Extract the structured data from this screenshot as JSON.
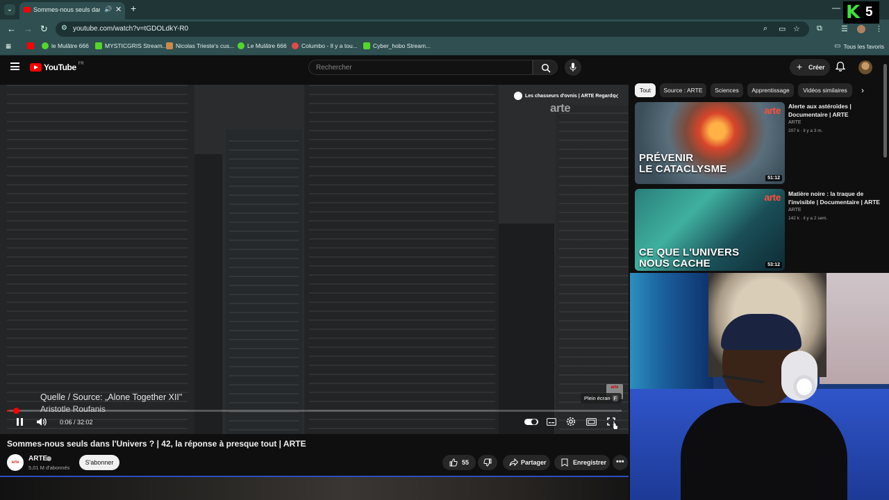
{
  "browser": {
    "tab_title": "Sommes-nous seuls dans l'Univers",
    "url": "youtube.com/watch?v=tGDOLdkY-R0",
    "bookmarks": [
      {
        "label": "",
        "color": "#ff0000"
      },
      {
        "label": "le Mulâtre 666",
        "color": "#53d72b"
      },
      {
        "label": "MYSTICGRIS Stream...",
        "color": "#53d72b"
      },
      {
        "label": "Nicolas Trieste's cus...",
        "color": "#c98a4a"
      },
      {
        "label": "Le Mulâtre 666",
        "color": "#53d72b"
      },
      {
        "label": "Columbo - Il y a tou...",
        "color": "#e04a4a"
      },
      {
        "label": "Cyber_hobo Stream...",
        "color": "#53d72b"
      }
    ],
    "all_bookmarks": "Tous les favoris"
  },
  "youtube": {
    "logo_text": "YouTube",
    "logo_country": "FR",
    "search_placeholder": "Rechercher",
    "create_label": "Créer"
  },
  "player": {
    "overlay_title": "Les chasseurs d'ovnis | ARTE Regards",
    "watermark": "arte",
    "source_line1": "Quelle / Source: „Alone Together XII\"",
    "source_line2": "Aristotle Roufanis",
    "fullscreen_tip": "Plein écran",
    "fullscreen_key": "F",
    "time": "0:06 / 32:02",
    "progress_fraction": 0.003
  },
  "video": {
    "title": "Sommes-nous seuls dans l'Univers ? | 42, la réponse à presque tout | ARTE",
    "channel": "ARTE",
    "subscribers": "5,01 M d'abonnés",
    "subscribe_label": "S'abonner",
    "likes": "55",
    "share_label": "Partager",
    "save_label": "Enregistrer"
  },
  "chips": [
    "Tout",
    "Source : ARTE",
    "Sciences",
    "Apprentissage",
    "Vidéos similaires"
  ],
  "recommendations": [
    {
      "thumb_text": "PRÉVENIR\nLE CATACLYSME",
      "duration": "51:12",
      "title": "Alerte aux astéroïdes | Documentaire | ARTE",
      "channel": "ARTE",
      "meta": "207 k · il y a 3 m."
    },
    {
      "thumb_text": "CE QUE L'UNIVERS\nNOUS CACHE",
      "duration": "53:12",
      "title": "Matière noire : la traque de l'invisible | Documentaire | ARTE",
      "channel": "ARTE",
      "meta": "142 k · il y a 2 sem."
    }
  ],
  "overlay_logo": {
    "letter": "K",
    "number": "5"
  }
}
